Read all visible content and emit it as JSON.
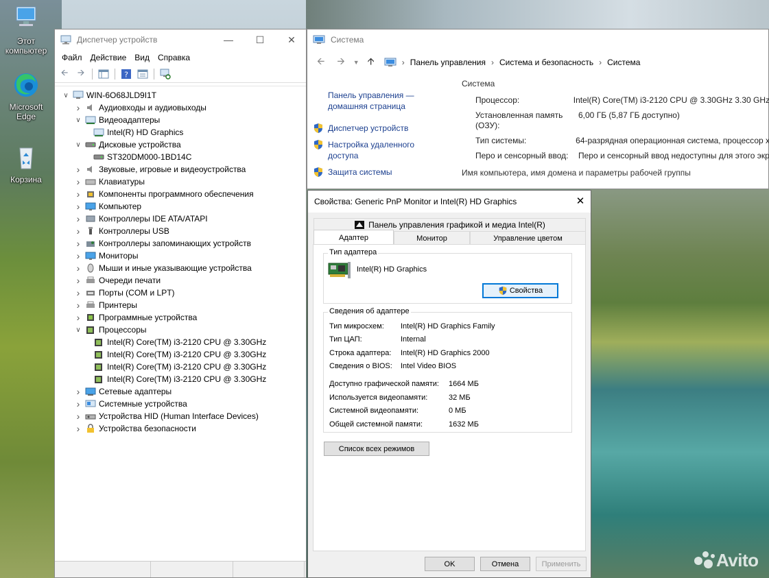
{
  "desktop": {
    "icons": [
      {
        "label": "Этот компьютер"
      },
      {
        "label": "Microsoft Edge"
      },
      {
        "label": "Корзина"
      }
    ],
    "watermark": "Avito"
  },
  "devmgr": {
    "title": "Диспетчер устройств",
    "menu": [
      "Файл",
      "Действие",
      "Вид",
      "Справка"
    ],
    "tree": [
      {
        "label": "WIN-6O68JLD9I1T",
        "level": 0,
        "arrow": "open",
        "icon": "computer-icon"
      },
      {
        "label": "Аудиовходы и аудиовыходы",
        "level": 1,
        "arrow": "closed",
        "icon": "speaker-icon"
      },
      {
        "label": "Видеоадаптеры",
        "level": 1,
        "arrow": "open",
        "icon": "display-adapter-icon"
      },
      {
        "label": "Intel(R) HD Graphics",
        "level": 2,
        "arrow": "none",
        "icon": "display-adapter-icon"
      },
      {
        "label": "Дисковые устройства",
        "level": 1,
        "arrow": "open",
        "icon": "disk-icon"
      },
      {
        "label": "ST320DM000-1BD14C",
        "level": 2,
        "arrow": "none",
        "icon": "disk-icon"
      },
      {
        "label": "Звуковые, игровые и видеоустройства",
        "level": 1,
        "arrow": "closed",
        "icon": "speaker-icon"
      },
      {
        "label": "Клавиатуры",
        "level": 1,
        "arrow": "closed",
        "icon": "keyboard-icon"
      },
      {
        "label": "Компоненты программного обеспечения",
        "level": 1,
        "arrow": "closed",
        "icon": "component-icon"
      },
      {
        "label": "Компьютер",
        "level": 1,
        "arrow": "closed",
        "icon": "monitor-icon"
      },
      {
        "label": "Контроллеры IDE ATA/ATAPI",
        "level": 1,
        "arrow": "closed",
        "icon": "controller-icon"
      },
      {
        "label": "Контроллеры USB",
        "level": 1,
        "arrow": "closed",
        "icon": "usb-icon"
      },
      {
        "label": "Контроллеры запоминающих устройств",
        "level": 1,
        "arrow": "closed",
        "icon": "storage-icon"
      },
      {
        "label": "Мониторы",
        "level": 1,
        "arrow": "closed",
        "icon": "monitor-icon"
      },
      {
        "label": "Мыши и иные указывающие устройства",
        "level": 1,
        "arrow": "closed",
        "icon": "mouse-icon"
      },
      {
        "label": "Очереди печати",
        "level": 1,
        "arrow": "closed",
        "icon": "printer-icon"
      },
      {
        "label": "Порты (COM и LPT)",
        "level": 1,
        "arrow": "closed",
        "icon": "port-icon"
      },
      {
        "label": "Принтеры",
        "level": 1,
        "arrow": "closed",
        "icon": "printer-icon"
      },
      {
        "label": "Программные устройства",
        "level": 1,
        "arrow": "closed",
        "icon": "software-device-icon"
      },
      {
        "label": "Процессоры",
        "level": 1,
        "arrow": "open",
        "icon": "cpu-icon"
      },
      {
        "label": "Intel(R) Core(TM) i3-2120 CPU @ 3.30GHz",
        "level": 2,
        "arrow": "none",
        "icon": "cpu-icon"
      },
      {
        "label": "Intel(R) Core(TM) i3-2120 CPU @ 3.30GHz",
        "level": 2,
        "arrow": "none",
        "icon": "cpu-icon"
      },
      {
        "label": "Intel(R) Core(TM) i3-2120 CPU @ 3.30GHz",
        "level": 2,
        "arrow": "none",
        "icon": "cpu-icon"
      },
      {
        "label": "Intel(R) Core(TM) i3-2120 CPU @ 3.30GHz",
        "level": 2,
        "arrow": "none",
        "icon": "cpu-icon"
      },
      {
        "label": "Сетевые адаптеры",
        "level": 1,
        "arrow": "closed",
        "icon": "network-icon"
      },
      {
        "label": "Системные устройства",
        "level": 1,
        "arrow": "closed",
        "icon": "system-device-icon"
      },
      {
        "label": "Устройства HID (Human Interface Devices)",
        "level": 1,
        "arrow": "closed",
        "icon": "hid-icon"
      },
      {
        "label": "Устройства безопасности",
        "level": 1,
        "arrow": "closed",
        "icon": "security-device-icon"
      }
    ]
  },
  "system": {
    "title": "Система",
    "breadcrumb": [
      "Панель управления",
      "Система и безопасность",
      "Система"
    ],
    "home_link": "Панель управления — домашняя страница",
    "links": [
      "Диспетчер устройств",
      "Настройка удаленного доступа",
      "Защита системы"
    ],
    "section_title": "Система",
    "rows": [
      {
        "k": "Процессор:",
        "v": "Intel(R) Core(TM) i3-2120 CPU @ 3.30GHz   3.30 GHz"
      },
      {
        "k": "Установленная память (ОЗУ):",
        "v": "6,00 ГБ (5,87 ГБ доступно)"
      },
      {
        "k": "Тип системы:",
        "v": "64-разрядная операционная система, процессор x"
      },
      {
        "k": "Перо и сенсорный ввод:",
        "v": "Перо и сенсорный ввод недоступны для этого экр"
      }
    ],
    "section2_title": "Имя компьютера, имя домена и параметры рабочей группы"
  },
  "props": {
    "title": "Свойства: Generic PnP Monitor и Intel(R) HD Graphics",
    "top_tab": "Панель управления графикой и медиа Intel(R)",
    "tabs": [
      "Адаптер",
      "Монитор",
      "Управление цветом"
    ],
    "adapter_type_group": "Тип адаптера",
    "adapter_name": "Intel(R) HD Graphics",
    "properties_button": "Свойства",
    "adapter_info_group": "Сведения об адаптере",
    "info": [
      {
        "k": "Тип микросхем:",
        "v": "Intel(R) HD Graphics Family"
      },
      {
        "k": "Тип ЦАП:",
        "v": "Internal"
      },
      {
        "k": "Строка адаптера:",
        "v": "Intel(R) HD Graphics 2000"
      },
      {
        "k": "Сведения о BIOS:",
        "v": "Intel Video BIOS"
      }
    ],
    "memory": [
      {
        "k": "Доступно графической памяти:",
        "v": "1664 МБ"
      },
      {
        "k": "Используется видеопамяти:",
        "v": "32 МБ"
      },
      {
        "k": "Системной видеопамяти:",
        "v": "0 МБ"
      },
      {
        "k": "Общей системной памяти:",
        "v": "1632 МБ"
      }
    ],
    "list_modes_button": "Список всех режимов",
    "ok": "OK",
    "cancel": "Отмена",
    "apply": "Применить"
  }
}
